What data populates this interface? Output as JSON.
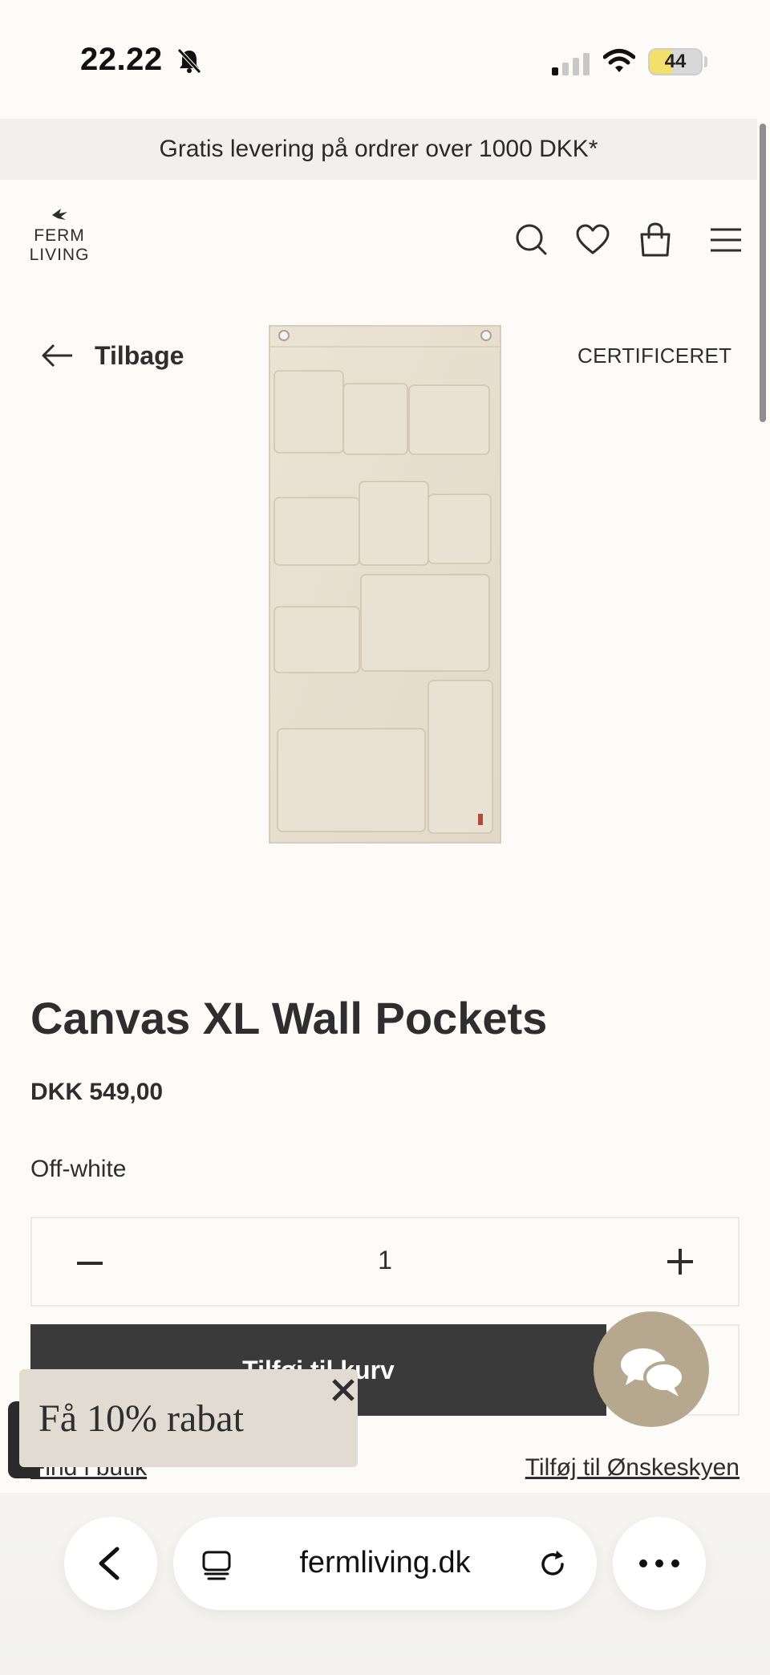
{
  "status_bar": {
    "time": "22.22",
    "battery": "44",
    "battery_level": 0.44
  },
  "announcement": "Gratis levering på ordrer over 1000 DKK*",
  "header": {
    "logo_line1": "FERM",
    "logo_line2": "LIVING",
    "icons": [
      "search-icon",
      "heart-icon",
      "bag-icon",
      "menu-icon"
    ]
  },
  "product": {
    "back_label": "Tilbage",
    "certified_label": "CERTIFICERET",
    "title": "Canvas XL Wall Pockets",
    "price": "DKK 549,00",
    "variant": "Off-white",
    "quantity": "1",
    "add_to_cart_label": "Tilføj til kurv",
    "find_store_label": "Find i butik",
    "add_wishlist_label": "Tilføj til Ønskeskyen"
  },
  "promo": {
    "text": "Få 10% rabat"
  },
  "browser": {
    "url": "fermliving.dk"
  },
  "colors": {
    "background": "#fcfbf8",
    "banner": "#f1f0ec",
    "cart_button": "#3a3a3a",
    "chat_button": "#b5a88f",
    "promo": "#e2dbd1",
    "canvas": "#e8e0d1"
  }
}
